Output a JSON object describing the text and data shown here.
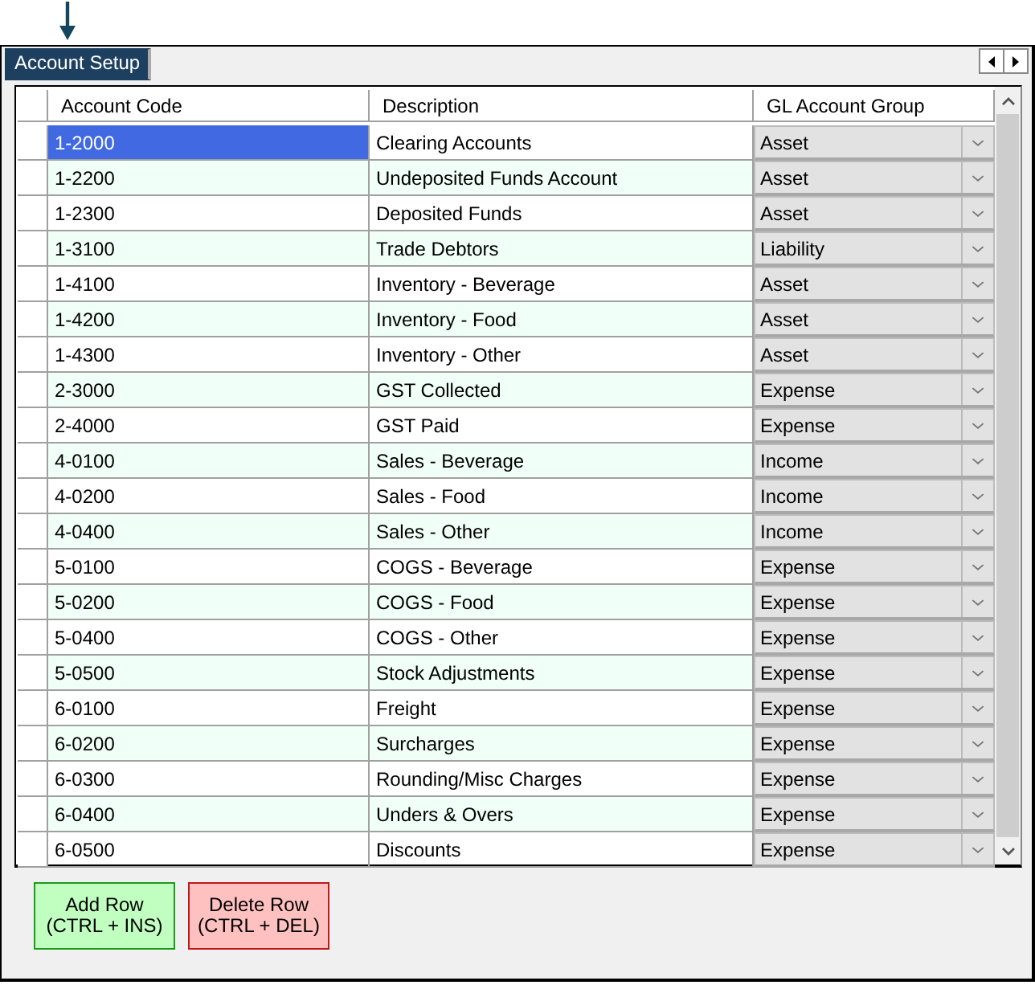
{
  "tabs": [
    {
      "label": "Account Setup",
      "selected": true
    }
  ],
  "table": {
    "columns": [
      "Account Code",
      "Description",
      "GL Account Group"
    ],
    "rows": [
      {
        "code": "1-2000",
        "description": "Clearing Accounts",
        "group": "Asset",
        "selected": true
      },
      {
        "code": "1-2200",
        "description": "Undeposited Funds Account",
        "group": "Asset",
        "selected": false
      },
      {
        "code": "1-2300",
        "description": "Deposited Funds",
        "group": "Asset",
        "selected": false
      },
      {
        "code": "1-3100",
        "description": "Trade Debtors",
        "group": "Liability",
        "selected": false
      },
      {
        "code": "1-4100",
        "description": "Inventory - Beverage",
        "group": "Asset",
        "selected": false
      },
      {
        "code": "1-4200",
        "description": "Inventory - Food",
        "group": "Asset",
        "selected": false
      },
      {
        "code": "1-4300",
        "description": "Inventory - Other",
        "group": "Asset",
        "selected": false
      },
      {
        "code": "2-3000",
        "description": "GST Collected",
        "group": "Expense",
        "selected": false
      },
      {
        "code": "2-4000",
        "description": "GST Paid",
        "group": "Expense",
        "selected": false
      },
      {
        "code": "4-0100",
        "description": "Sales - Beverage",
        "group": "Income",
        "selected": false
      },
      {
        "code": "4-0200",
        "description": "Sales - Food",
        "group": "Income",
        "selected": false
      },
      {
        "code": "4-0400",
        "description": "Sales - Other",
        "group": "Income",
        "selected": false
      },
      {
        "code": "5-0100",
        "description": "COGS - Beverage",
        "group": "Expense",
        "selected": false
      },
      {
        "code": "5-0200",
        "description": "COGS - Food",
        "group": "Expense",
        "selected": false
      },
      {
        "code": "5-0400",
        "description": "COGS - Other",
        "group": "Expense",
        "selected": false
      },
      {
        "code": "5-0500",
        "description": "Stock Adjustments",
        "group": "Expense",
        "selected": false
      },
      {
        "code": "6-0100",
        "description": "Freight",
        "group": "Expense",
        "selected": false
      },
      {
        "code": "6-0200",
        "description": "Surcharges",
        "group": "Expense",
        "selected": false
      },
      {
        "code": "6-0300",
        "description": "Rounding/Misc Charges",
        "group": "Expense",
        "selected": false
      },
      {
        "code": "6-0400",
        "description": "Unders & Overs",
        "group": "Expense",
        "selected": false
      },
      {
        "code": "6-0500",
        "description": "Discounts",
        "group": "Expense",
        "selected": false
      }
    ]
  },
  "buttons": [
    {
      "kind": "add",
      "label": "Add Row",
      "shortcut": "(CTRL + INS)"
    },
    {
      "kind": "delete",
      "label": "Delete Row",
      "shortcut": "(CTRL + DEL)"
    }
  ]
}
